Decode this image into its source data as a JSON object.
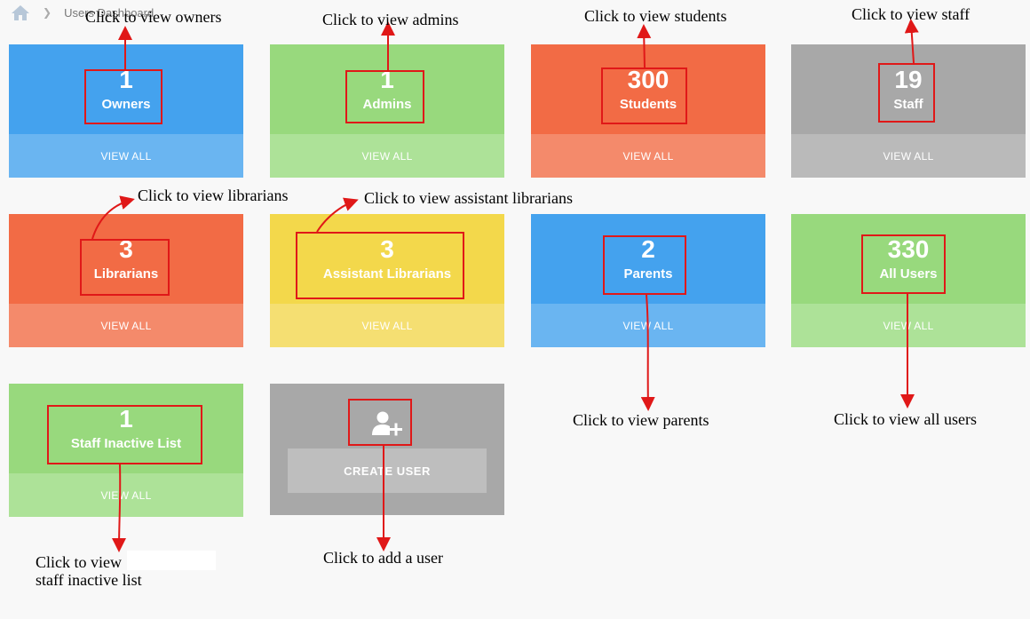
{
  "breadcrumb": {
    "label": "Users Dashboard",
    "icon": "home-icon"
  },
  "cards": [
    {
      "number": "1",
      "label": "Owners",
      "view_all": "VIEW ALL",
      "color": "#44a2ee"
    },
    {
      "number": "1",
      "label": "Admins",
      "view_all": "VIEW ALL",
      "color": "#98d97d"
    },
    {
      "number": "300",
      "label": "Students",
      "view_all": "VIEW ALL",
      "color": "#f26b45"
    },
    {
      "number": "19",
      "label": "Staff",
      "view_all": "VIEW ALL",
      "color": "#a8a8a8"
    },
    {
      "number": "3",
      "label": "Librarians",
      "view_all": "VIEW ALL",
      "color": "#f26b45"
    },
    {
      "number": "3",
      "label": "Assistant Librarians",
      "view_all": "VIEW ALL",
      "color": "#f3d84b"
    },
    {
      "number": "2",
      "label": "Parents",
      "view_all": "VIEW ALL",
      "color": "#44a2ee"
    },
    {
      "number": "330",
      "label": "All Users",
      "view_all": "VIEW ALL",
      "color": "#98d97d"
    },
    {
      "number": "1",
      "label": "Staff Inactive List",
      "view_all": "VIEW ALL",
      "color": "#98d97d"
    }
  ],
  "create_user": {
    "label": "CREATE USER",
    "icon": "user-add-icon"
  },
  "annotations": {
    "owners": "Click to view owners",
    "admins": "Click to view admins",
    "students": "Click to view students",
    "staff": "Click to view staff",
    "librarians": "Click to view librarians",
    "assistant_librarians": "Click to view assistant librarians",
    "parents": "Click to view parents",
    "all_users": "Click to view all users",
    "staff_inactive_line1": "Click to view",
    "staff_inactive_line2": "staff inactive list",
    "add_user": "Click to add a user"
  },
  "colors": {
    "annotation": "#e01818"
  }
}
